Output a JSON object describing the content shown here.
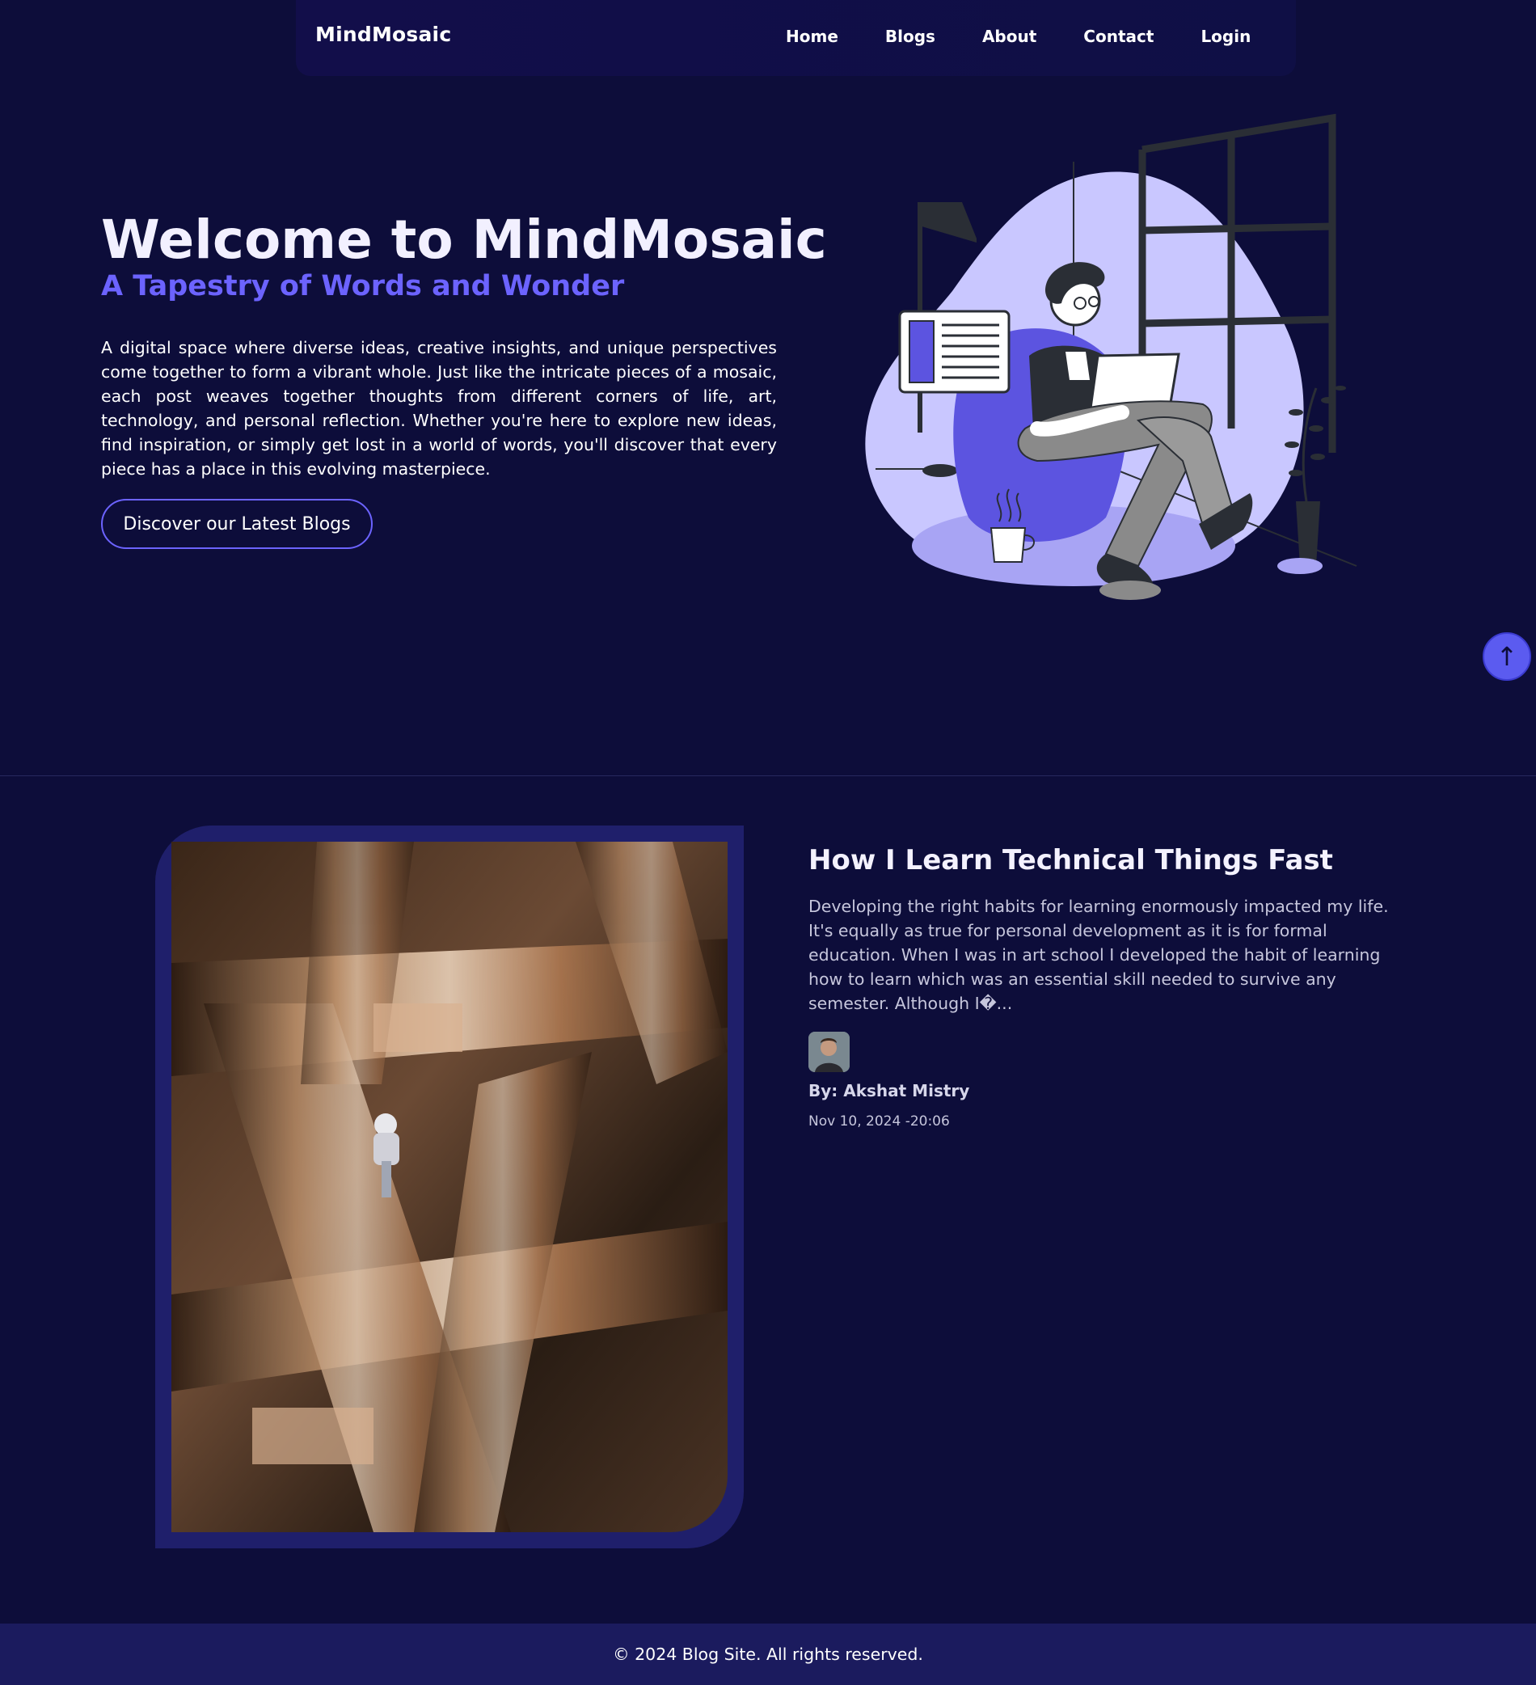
{
  "colors": {
    "background": "#0d0d3a",
    "accent": "#6c63ff",
    "navbar": "#120e4a",
    "footer": "#1b1b5e",
    "card_frame": "#1f1f6b"
  },
  "navbar": {
    "brand": "MindMosaic",
    "links": [
      {
        "label": "Home"
      },
      {
        "label": "Blogs"
      },
      {
        "label": "About"
      },
      {
        "label": "Contact"
      },
      {
        "label": "Login"
      }
    ]
  },
  "hero": {
    "title": "Welcome to MindMosaic",
    "subtitle": "A Tapestry of Words and Wonder",
    "description": "A digital space where diverse ideas, creative insights, and unique perspectives come together to form a vibrant whole. Just like the intricate pieces of a mosaic, each post weaves together thoughts from different corners of life, art, technology, and personal reflection. Whether you're here to explore new ideas, find inspiration, or simply get lost in a world of words, you'll discover that every piece has a place in this evolving masterpiece.",
    "cta_label": "Discover our Latest Blogs",
    "illustration_icon": "person-reading-laptop-illustration"
  },
  "scroll_top": {
    "icon": "arrow-up-icon",
    "glyph": "↑"
  },
  "featured_post": {
    "image_icon": "astronaut-library-image",
    "title": "How I Learn Technical Things Fast",
    "excerpt": "Developing the right habits for learning enormously impacted my life. It's equally as true for personal development as it is for formal education. When I was in art school I developed the habit of learning how to learn which was an essential skill needed to survive any semester. Although I�...",
    "author_avatar_icon": "author-avatar",
    "author": "By: Akshat Mistry",
    "date": "Nov 10, 2024 -20:06"
  },
  "footer": {
    "text": "© 2024 Blog Site. All rights reserved."
  }
}
